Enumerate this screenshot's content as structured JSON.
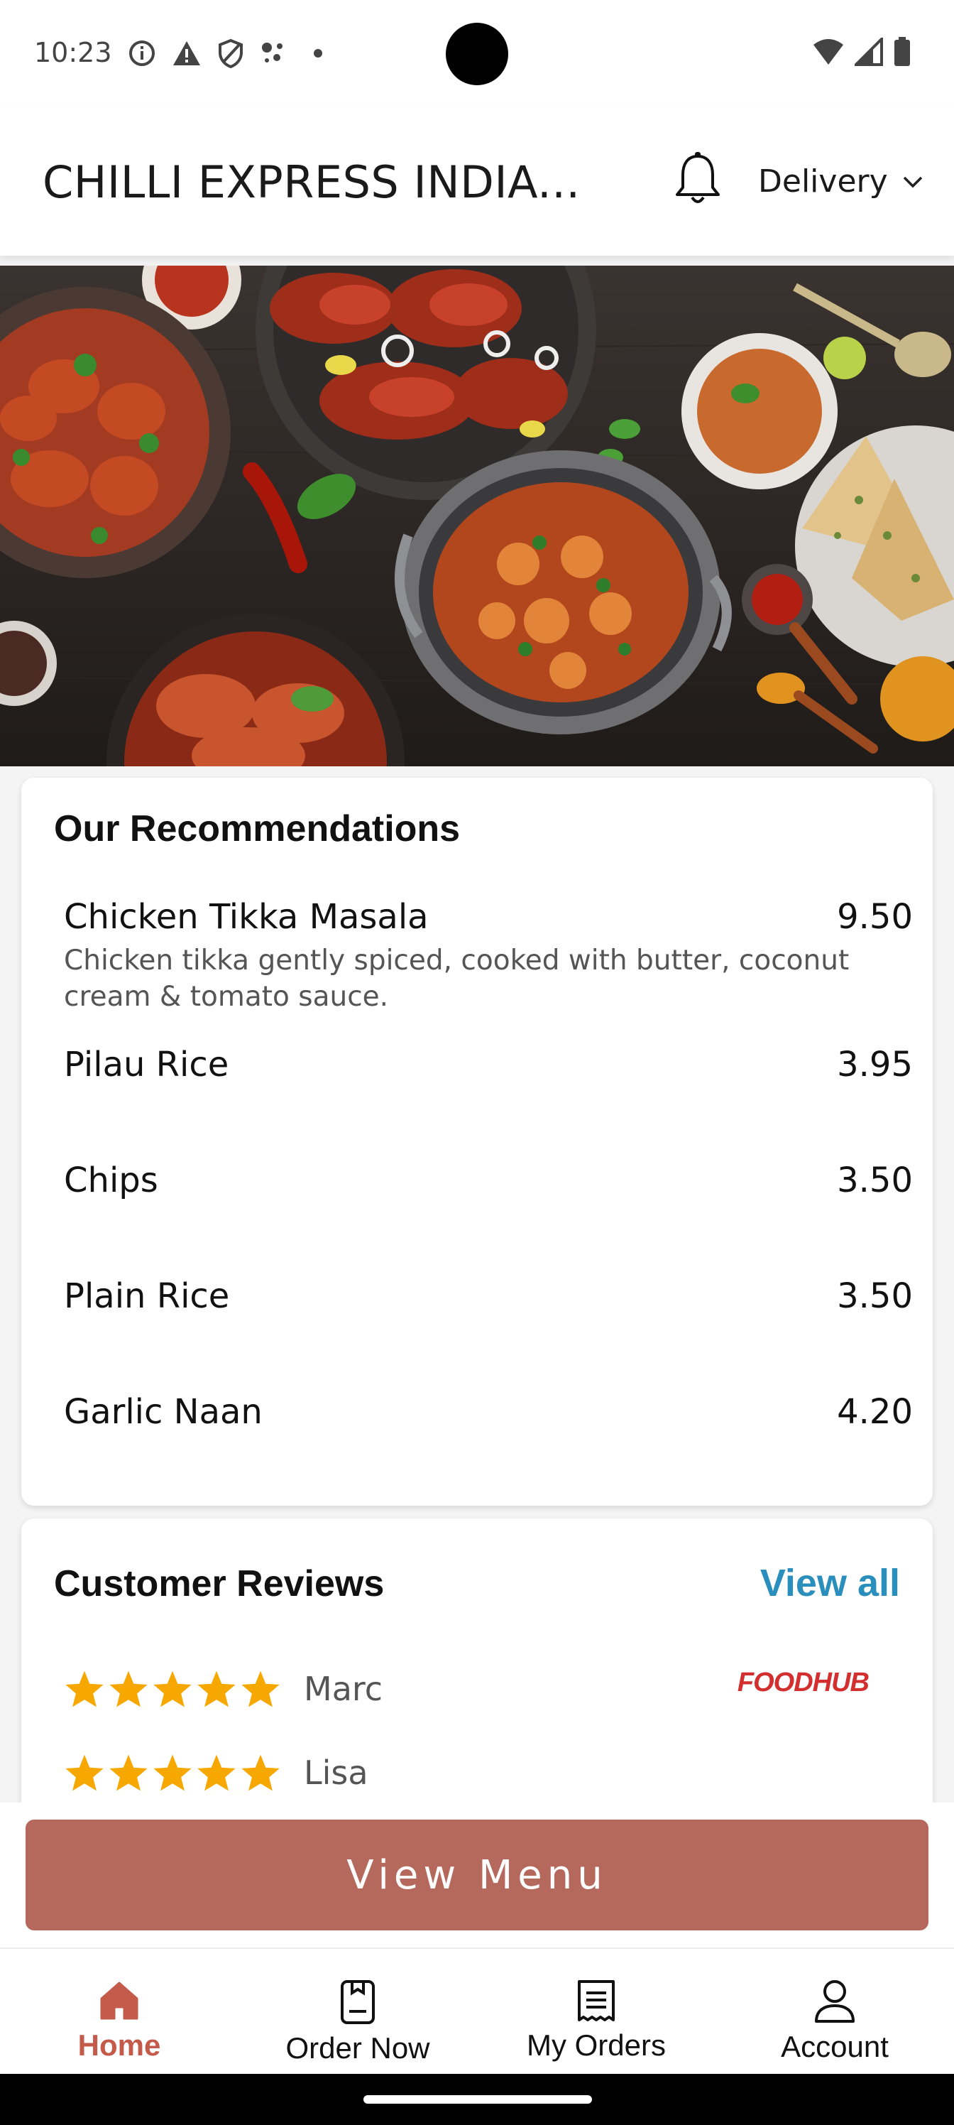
{
  "status_bar": {
    "time": "10:23",
    "left_icons": [
      "info-icon",
      "warning-icon",
      "shield-icon",
      "assistant-dots-icon",
      "dot-icon"
    ],
    "right_icons": [
      "wifi-icon",
      "signal-icon",
      "battery-icon"
    ]
  },
  "header": {
    "title": "CHILLI EXPRESS INDIA...",
    "notification_icon": "bell-icon",
    "order_mode": "Delivery"
  },
  "hero": {
    "description": "food banner"
  },
  "recommendations": {
    "title": "Our Recommendations",
    "items": [
      {
        "name": "Chicken Tikka Masala",
        "price": "9.50",
        "description": "Chicken tikka gently spiced, cooked with butter, coconut cream & tomato sauce."
      },
      {
        "name": "Pilau Rice",
        "price": "3.95"
      },
      {
        "name": "Chips",
        "price": "3.50"
      },
      {
        "name": "Plain Rice",
        "price": "3.50"
      },
      {
        "name": "Garlic Naan",
        "price": "4.20"
      }
    ]
  },
  "reviews": {
    "title": "Customer Reviews",
    "view_all_label": "View all",
    "source": "FOODHUB",
    "items": [
      {
        "name": "Marc",
        "rating": 5
      },
      {
        "name": "Lisa",
        "rating": 5
      }
    ]
  },
  "view_menu_label": "View Menu",
  "bottom_nav": [
    {
      "label": "Home",
      "icon": "home-icon",
      "active": true
    },
    {
      "label": "Order Now",
      "icon": "order-icon",
      "active": false
    },
    {
      "label": "My Orders",
      "icon": "receipt-icon",
      "active": false
    },
    {
      "label": "Account",
      "icon": "account-icon",
      "active": false
    }
  ],
  "colors": {
    "accent": "#b5685c",
    "active_nav": "#c45a4a",
    "link": "#2a8fbd",
    "star": "#f6a800"
  }
}
